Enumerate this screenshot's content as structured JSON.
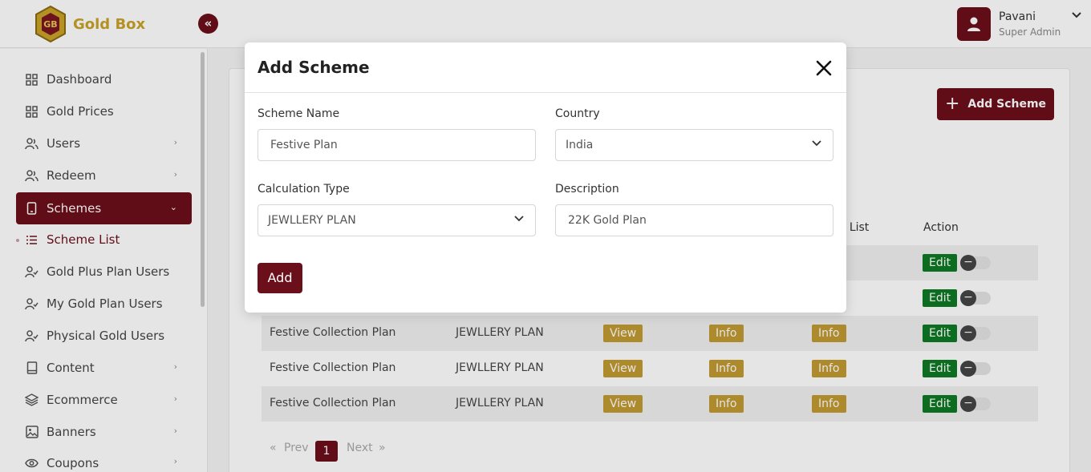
{
  "brand": {
    "name": "Gold Box",
    "logo_letters": "GB"
  },
  "colors": {
    "primary": "#6b0f1a",
    "gold": "#c19a30",
    "green": "#0e7a24"
  },
  "user": {
    "name": "Pavani",
    "role": "Super Admin"
  },
  "sidebar": {
    "items": [
      {
        "label": "Dashboard",
        "icon": "grid-icon"
      },
      {
        "label": "Gold Prices",
        "icon": "grid-icon"
      },
      {
        "label": "Users",
        "icon": "users-icon",
        "has_submenu": true
      },
      {
        "label": "Redeem",
        "icon": "users-icon",
        "has_submenu": true
      },
      {
        "label": "Schemes",
        "icon": "tablet-icon",
        "active": true,
        "expanded": true
      },
      {
        "label": "Scheme List",
        "icon": "list-icon",
        "sub": true
      },
      {
        "label": "Gold Plus Plan Users",
        "icon": "user-check-icon"
      },
      {
        "label": "My Gold Plan Users",
        "icon": "user-check-icon"
      },
      {
        "label": "Physical Gold Users",
        "icon": "user-check-icon"
      },
      {
        "label": "Content",
        "icon": "book-icon",
        "has_submenu": true
      },
      {
        "label": "Ecommerce",
        "icon": "layers-icon",
        "has_submenu": true
      },
      {
        "label": "Banners",
        "icon": "image-icon",
        "has_submenu": true
      },
      {
        "label": "Coupons",
        "icon": "eye-icon",
        "has_submenu": true
      }
    ]
  },
  "main": {
    "add_button_label": "Add Scheme",
    "table": {
      "headers": {
        "partial_list": "nt List",
        "action": "Action"
      },
      "rows": [
        {
          "name": "",
          "type": "",
          "view": "",
          "info1": "",
          "info2": "",
          "edit": "Edit"
        },
        {
          "name": "",
          "type": "",
          "view": "",
          "info1": "",
          "info2": "",
          "edit": "Edit"
        },
        {
          "name": "Festive Collection Plan",
          "type": "JEWLLERY PLAN",
          "view": "View",
          "info1": "Info",
          "info2": "Info",
          "edit": "Edit"
        },
        {
          "name": "Festive Collection Plan",
          "type": "JEWLLERY PLAN",
          "view": "View",
          "info1": "Info",
          "info2": "Info",
          "edit": "Edit"
        },
        {
          "name": "Festive Collection Plan",
          "type": "JEWLLERY PLAN",
          "view": "View",
          "info1": "Info",
          "info2": "Info",
          "edit": "Edit"
        }
      ]
    },
    "pagination": {
      "first": "«",
      "prev": "Prev",
      "current": "1",
      "next": "Next",
      "last": "»"
    }
  },
  "modal": {
    "title": "Add Scheme",
    "fields": {
      "scheme_name": {
        "label": "Scheme Name",
        "value": "Festive Plan"
      },
      "country": {
        "label": "Country",
        "value": "India"
      },
      "calculation_type": {
        "label": "Calculation Type",
        "value": "JEWLLERY PLAN"
      },
      "description": {
        "label": "Description",
        "value": "22K Gold Plan"
      }
    },
    "submit_label": "Add"
  }
}
